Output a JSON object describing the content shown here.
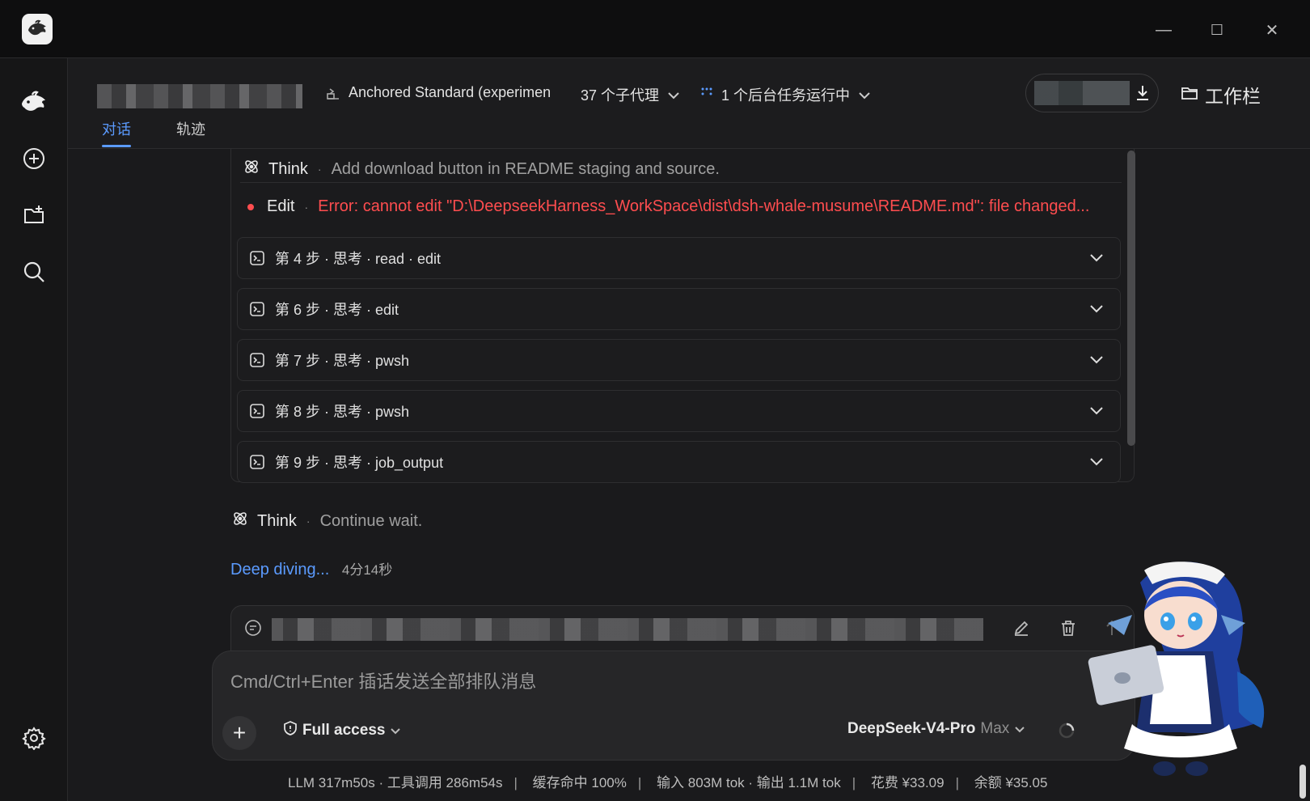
{
  "titlebar": {
    "minimize": "—",
    "maximize": "☐",
    "close": "✕"
  },
  "header": {
    "mode_label": "Anchored Standard (experimen",
    "subagents": "37 个子代理",
    "background_tasks": "1 个后台任务运行中",
    "workbar_label": "工作栏",
    "tabs": [
      "对话",
      "轨迹"
    ]
  },
  "log": {
    "think_label": "Think",
    "think_text": "Add download button in README staging and source.",
    "edit_label": "Edit",
    "edit_error": "Error: cannot edit \"D:\\DeepseekHarness_WorkSpace\\dist\\dsh-whale-musume\\README.md\": file changed...",
    "steps": [
      "第 4 步 · 思考 · read · edit",
      "第 6 步 · 思考 · edit",
      "第 7 步 · 思考 · pwsh",
      "第 8 步 · 思考 · pwsh",
      "第 9 步 · 思考 · job_output"
    ],
    "think2_label": "Think",
    "think2_text": "Continue wait.",
    "deep_diving": "Deep diving...",
    "elapsed": "4分14秒"
  },
  "composer": {
    "placeholder": "Cmd/Ctrl+Enter 插话发送全部排队消息",
    "access": "Full access",
    "model": "DeepSeek-V4-Pro",
    "model_tier": "Max"
  },
  "status": {
    "llm": "LLM 317m50s · 工具调用 286m54s",
    "cache": "缓存命中 100%",
    "tokens": "输入 803M tok · 输出 1.1M tok",
    "cost": "花费 ¥33.09",
    "balance": "余额 ¥35.05",
    "separator": "|"
  },
  "colors": {
    "accent": "#5b9bff",
    "error": "#ff4d4f",
    "bg": "#1a1a1c"
  }
}
